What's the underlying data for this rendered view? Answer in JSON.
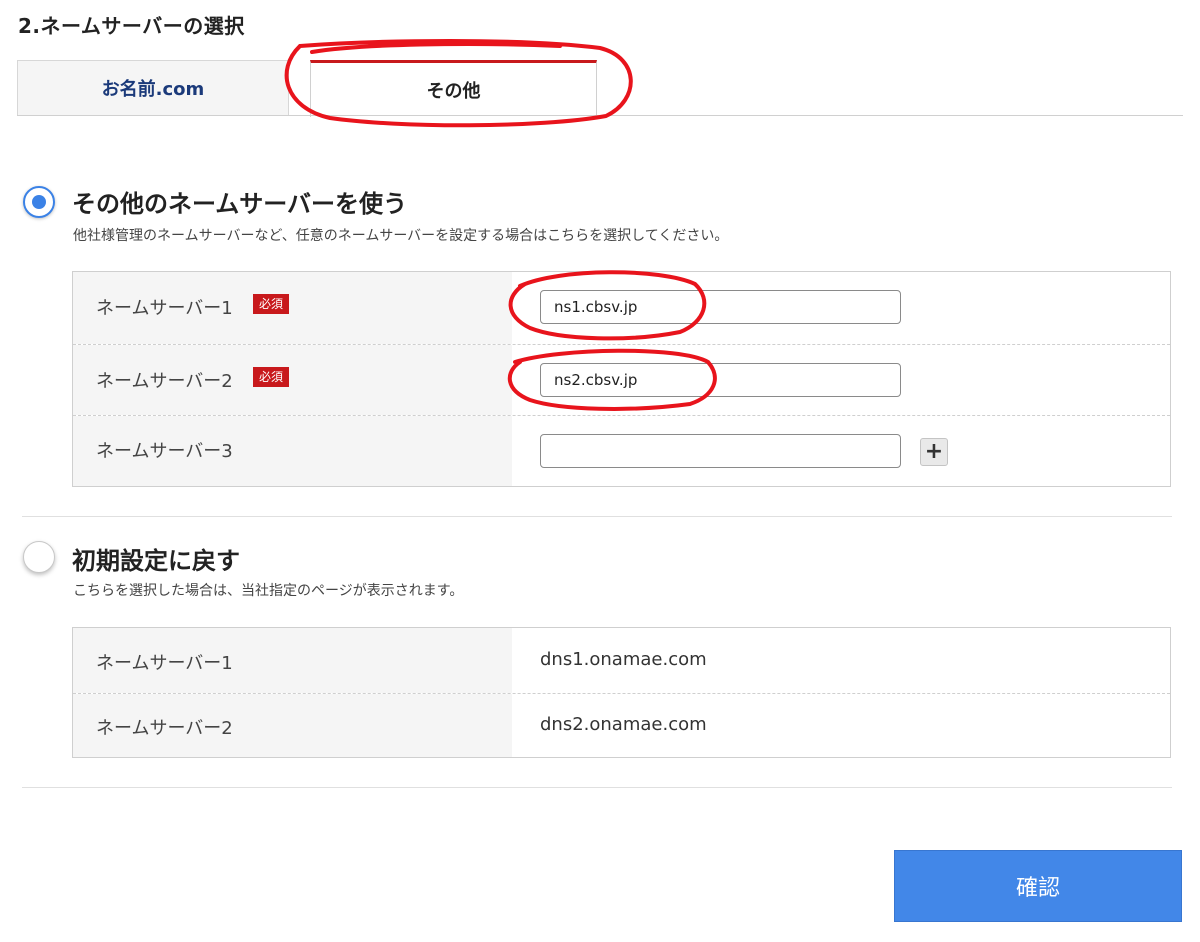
{
  "page_title": "2.ネームサーバーの選択",
  "tabs": [
    {
      "label": "お名前.com",
      "active": false
    },
    {
      "label": "その他",
      "active": true
    }
  ],
  "option_custom": {
    "title": "その他のネームサーバーを使う",
    "description": "他社様管理のネームサーバーなど、任意のネームサーバーを設定する場合はこちらを選択してください。",
    "selected": true,
    "rows": [
      {
        "label": "ネームサーバー1",
        "badge": "必須",
        "value": "ns1.cbsv.jp"
      },
      {
        "label": "ネームサーバー2",
        "badge": "必須",
        "value": "ns2.cbsv.jp"
      },
      {
        "label": "ネームサーバー3",
        "value": ""
      }
    ],
    "add_button": "+"
  },
  "option_default": {
    "title": "初期設定に戻す",
    "description": "こちらを選択した場合は、当社指定のページが表示されます。",
    "selected": false,
    "rows": [
      {
        "label": "ネームサーバー1",
        "value": "dns1.onamae.com"
      },
      {
        "label": "ネームサーバー2",
        "value": "dns2.onamae.com"
      }
    ]
  },
  "confirm_label": "確認",
  "colors": {
    "accent_blue": "#4287e8",
    "required_red": "#c8191c",
    "annotation_red": "#e8141c"
  }
}
